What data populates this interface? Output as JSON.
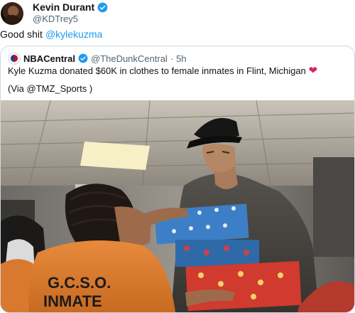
{
  "tweet": {
    "author_name": "Kevin Durant",
    "author_handle": "@KDTrey5",
    "text": "Good shit",
    "mention": "@kylekuzma"
  },
  "quoted": {
    "author_name": "NBACentral",
    "author_handle": "@TheDunkCentral",
    "separator": "·",
    "time": "5h",
    "text": "Kyle Kuzma donated $60K in clothes to female inmates in Flint, Michigan",
    "emoji": "❤",
    "via": "(Via @TMZ_Sports )",
    "photo_shirt_text": "G.C.S.O.",
    "photo_shirt_text2": "INMATE"
  },
  "colors": {
    "link": "#1d9bf0",
    "verified": "#1d9bf0",
    "heart": "#e0245e",
    "muted": "#536471"
  }
}
